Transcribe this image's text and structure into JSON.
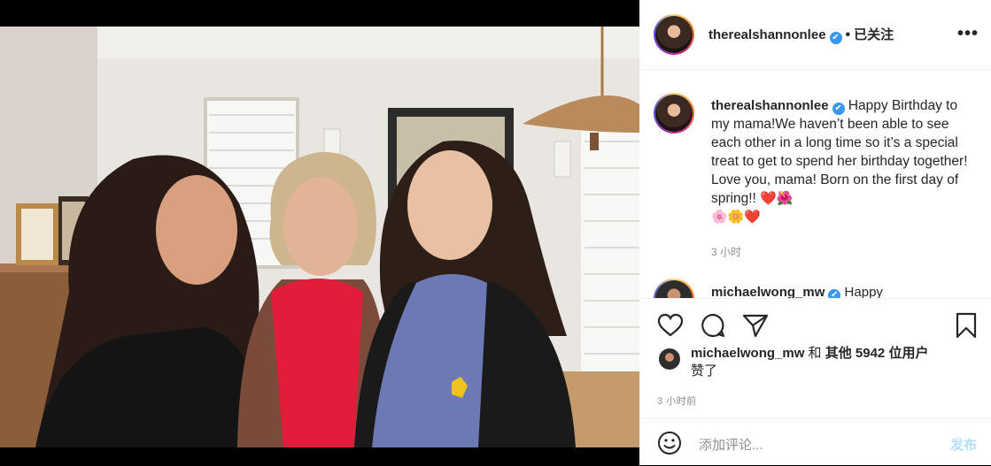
{
  "header": {
    "username": "therealshannonlee",
    "verified_mark": "✔",
    "separator": "•",
    "follow_status": "已关注",
    "more_icon": "more-options-icon"
  },
  "caption": {
    "username": "therealshannonlee",
    "verified_mark": "✔",
    "text": "Happy Birthday to my mama!We haven’t been able to see each other in a long time so it’s a special treat to get to spend her birthday together! Love you, mama! Born on the first day of spring!!",
    "emojis_inline": "❤️🌺",
    "emojis_line": "🌸🌼❤️",
    "time": "3 小时"
  },
  "next_comment": {
    "username": "michaelwong_mw",
    "verified_mark": "✔",
    "text": "Happy"
  },
  "likes": {
    "first_liker": "michaelwong_mw",
    "and_text": "和",
    "others_text": "其他 5942 位用户",
    "liked_text": "赞了"
  },
  "post_time": "3 小时前",
  "add_comment": {
    "placeholder": "添加评论...",
    "post_label": "发布"
  },
  "colors": {
    "link_blue": "#0095f6",
    "post_disabled": "#b2dffc",
    "verified": "#3897f0"
  }
}
